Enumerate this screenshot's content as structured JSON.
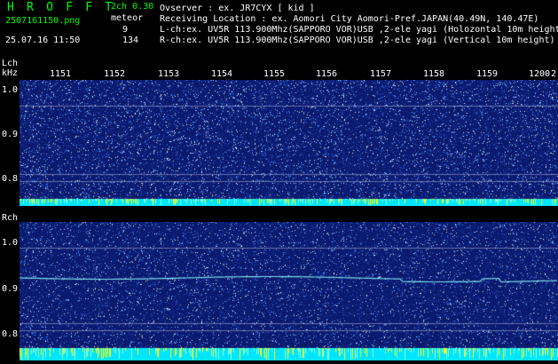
{
  "app": {
    "title": "H R O F F T",
    "version": "2ch 0.30"
  },
  "header": {
    "filename": "2507161150.png",
    "datetime": "25.07.16 11:50",
    "meteor_label": "meteor",
    "count_l": "9",
    "count_r": "134",
    "lines": [
      "Ovserver           : ex. JR7CYX [ kid ]",
      "Receiving Location : ex. Aomori City Aomori-Pref.JAPAN(40.49N, 140.47E)",
      "L-ch:ex. UV5R 113.900Mhz(SAPPORO VOR)USB ,2-ele yagi (Holozontal 10m height)",
      "R-ch:ex. UV5R 113.900Mhz(SAPPORO VOR)USB ,2-ele yagi (Vertical 10m height)"
    ]
  },
  "time_axis": {
    "ticks": [
      "1151",
      "1152",
      "1153",
      "1154",
      "1155",
      "1156",
      "1157",
      "1158",
      "1159",
      "1200"
    ],
    "edge_label": "2"
  },
  "lch": {
    "label": "Lch",
    "unit": "kHz",
    "ticks": [
      "1.0",
      "0.9",
      "0.8"
    ]
  },
  "rch": {
    "label": "Rch",
    "ticks": [
      "1.0",
      "0.9",
      "0.8"
    ]
  },
  "colors": {
    "noise_bg": "#0a1a6e",
    "green": "#00ff00",
    "cyan": "#00e5ff",
    "yellow": "#ffff00"
  }
}
